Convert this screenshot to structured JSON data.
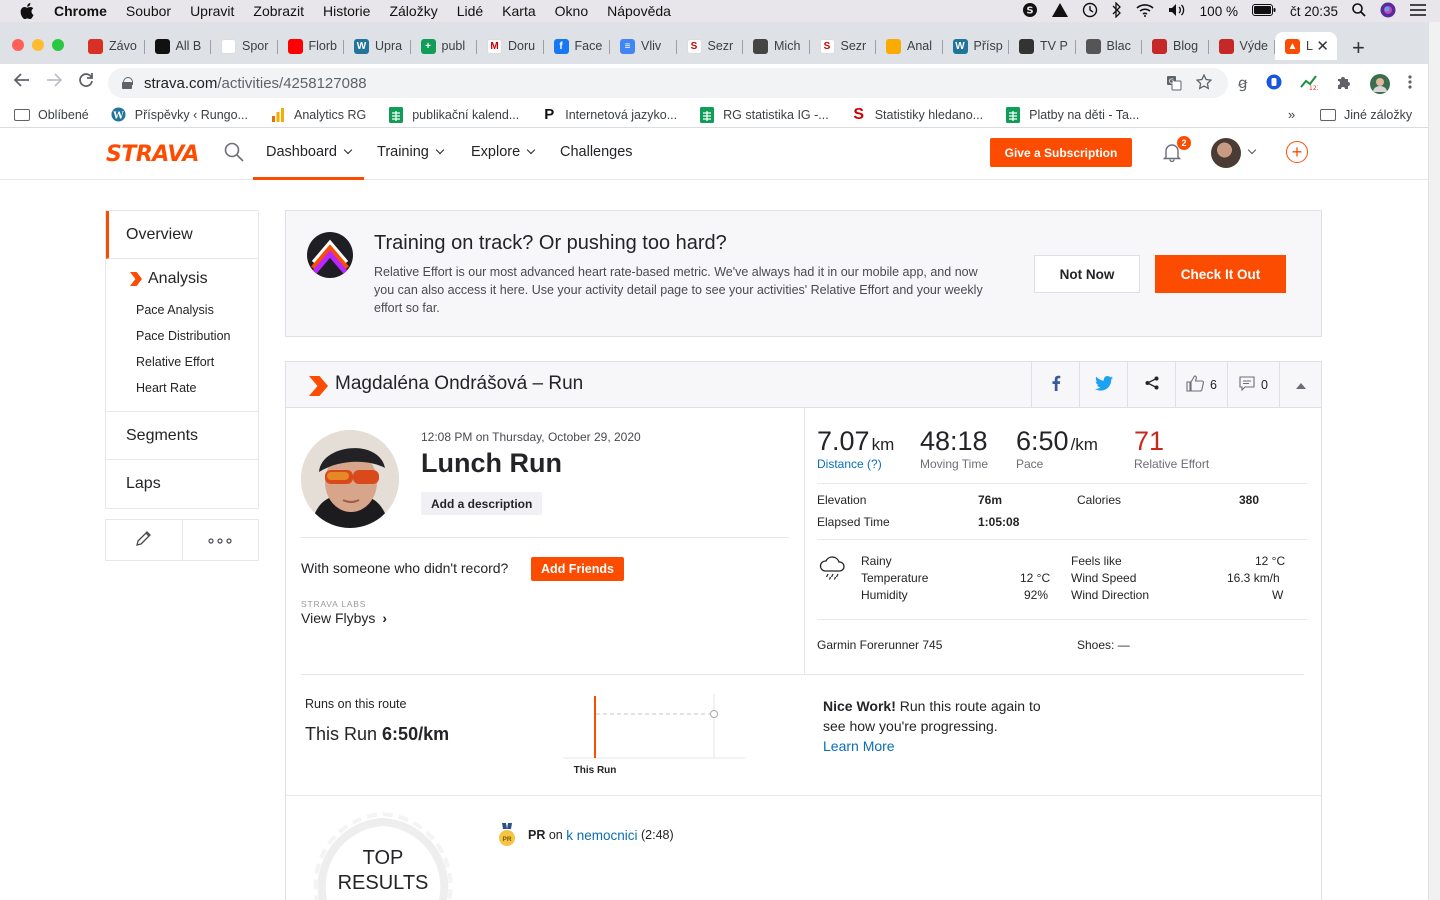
{
  "macos": {
    "app": "Chrome",
    "menus": [
      "Soubor",
      "Upravit",
      "Zobrazit",
      "Historie",
      "Záložky",
      "Lidé",
      "Karta",
      "Okno",
      "Nápověda"
    ],
    "battery": "100 %",
    "clock": "čt 20:35"
  },
  "tabs": [
    {
      "label": "Závo",
      "color": "#d93025",
      "glyph": ""
    },
    {
      "label": "All B",
      "color": "#111111",
      "glyph": ""
    },
    {
      "label": "Spor",
      "color": "#ffffff",
      "glyph": ""
    },
    {
      "label": "Florb",
      "color": "#ff0000",
      "glyph": ""
    },
    {
      "label": "Upra",
      "color": "#21759b",
      "glyph": "W"
    },
    {
      "label": "publ",
      "color": "#0f9d58",
      "glyph": "+"
    },
    {
      "label": "Doru",
      "color": "#ffffff",
      "glyph": "M"
    },
    {
      "label": "Face",
      "color": "#1877f2",
      "glyph": "f"
    },
    {
      "label": "Vliv",
      "color": "#4285f4",
      "glyph": "≡"
    },
    {
      "label": "Sezr",
      "color": "#ffffff",
      "glyph": "S"
    },
    {
      "label": "Mich",
      "color": "#444444",
      "glyph": ""
    },
    {
      "label": "Sezr",
      "color": "#ffffff",
      "glyph": "S"
    },
    {
      "label": "Anal",
      "color": "#f9ab00",
      "glyph": ""
    },
    {
      "label": "Přísp",
      "color": "#21759b",
      "glyph": "W"
    },
    {
      "label": "TV P",
      "color": "#333333",
      "glyph": ""
    },
    {
      "label": "Blac",
      "color": "#555555",
      "glyph": ""
    },
    {
      "label": "Blog",
      "color": "#c62828",
      "glyph": ""
    },
    {
      "label": "Výde",
      "color": "#c62828",
      "glyph": ""
    }
  ],
  "active_tab": {
    "label": "L"
  },
  "address": {
    "host": "strava.com",
    "path": "/activities/4258127088"
  },
  "bookmarks": [
    {
      "label": "Oblíbené",
      "type": "folder"
    },
    {
      "label": "Příspěvky ‹ Rungo...",
      "type": "wp"
    },
    {
      "label": "Analytics RG",
      "type": "analytics"
    },
    {
      "label": "publikační kalend...",
      "type": "sheet"
    },
    {
      "label": "Internetová jazyko...",
      "type": "p"
    },
    {
      "label": "RG statistika IG -...",
      "type": "sheet"
    },
    {
      "label": "Statistiky hledano...",
      "type": "s"
    },
    {
      "label": "Platby na děti - Ta...",
      "type": "sheet"
    }
  ],
  "bookmarks_more": "»",
  "bookmarks_other": "Jiné záložky",
  "strava": {
    "logo": "STRAVA",
    "nav": [
      "Dashboard",
      "Training",
      "Explore",
      "Challenges"
    ],
    "subscribe": "Give a Subscription",
    "notifications": "2"
  },
  "sidebar": {
    "overview": "Overview",
    "analysis": "Analysis",
    "analysis_items": [
      "Pace Analysis",
      "Pace Distribution",
      "Relative Effort",
      "Heart Rate"
    ],
    "segments": "Segments",
    "laps": "Laps"
  },
  "promo": {
    "title": "Training on track? Or pushing too hard?",
    "body": "Relative Effort is our most advanced heart rate-based metric. We've always had it in our mobile app, and now you can also access it here. Use your activity detail page to see your activities' Relative Effort and your weekly effort so far.",
    "not_now": "Not Now",
    "check": "Check It Out"
  },
  "activity": {
    "header": "Magdaléna Ondrášová – Run",
    "kudos": "6",
    "comments": "0",
    "when": "12:08 PM on Thursday, October 29, 2020",
    "name": "Lunch Run",
    "add_description": "Add a description",
    "with_someone": "With someone who didn't record?",
    "add_friends": "Add Friends",
    "labs": "STRAVA LABS",
    "flybys": "View Flybys",
    "stats": {
      "distance": {
        "value": "7.07",
        "unit": "km",
        "label": "Distance (?)"
      },
      "moving_time": {
        "value": "48:18",
        "label": "Moving Time"
      },
      "pace": {
        "value": "6:50",
        "unit": "/km",
        "label": "Pace"
      },
      "relative_effort": {
        "value": "71",
        "label": "Relative Effort"
      }
    },
    "details": {
      "elevation_label": "Elevation",
      "elevation": "76m",
      "calories_label": "Calories",
      "calories": "380",
      "elapsed_label": "Elapsed Time",
      "elapsed": "1:05:08"
    },
    "weather": {
      "condition": "Rainy",
      "temp_label": "Temperature",
      "temp": "12 °C",
      "humidity_label": "Humidity",
      "humidity": "92%",
      "feels_label": "Feels like",
      "feels": "12 °C",
      "wind_label": "Wind Speed",
      "wind": "16.3 km/h",
      "dir_label": "Wind Direction",
      "dir": "W"
    },
    "device": "Garmin Forerunner 745",
    "shoes": "Shoes: —",
    "route": {
      "title": "Runs on this route",
      "this_run_label": "This Run",
      "this_run_pace": "6:50/km",
      "chart_label": "This Run",
      "nice_work": "Nice Work!",
      "nice_text": " Run this route again to see how you're progressing.",
      "learn_more": "Learn More"
    },
    "top_results": {
      "line1": "TOP",
      "line2": "RESULTS"
    },
    "pr": {
      "badge": "PR",
      "label": "PR",
      "on": " on ",
      "segment": "k nemocnici",
      "time": " (2:48)"
    }
  }
}
